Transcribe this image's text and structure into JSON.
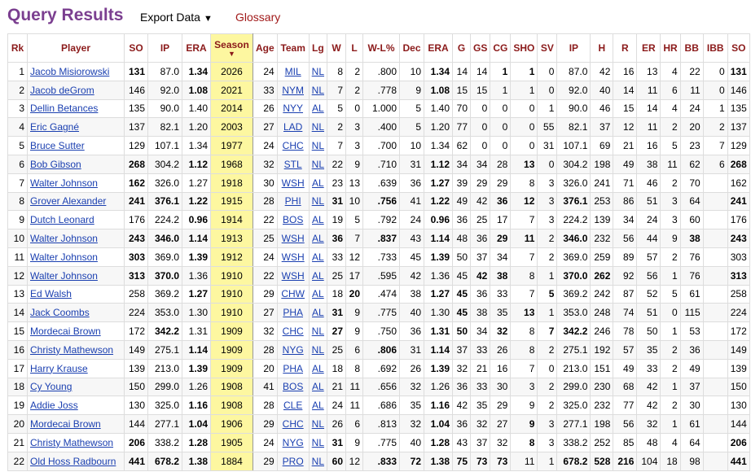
{
  "header": {
    "title": "Query Results",
    "export_label": "Export Data",
    "export_caret": "▼",
    "glossary_label": "Glossary"
  },
  "table": {
    "columns": [
      "Rk",
      "Player",
      "SO",
      "IP",
      "ERA",
      "Season",
      "Age",
      "Team",
      "Lg",
      "W",
      "L",
      "W-L%",
      "Dec",
      "ERA",
      "G",
      "GS",
      "CG",
      "SHO",
      "SV",
      "IP",
      "H",
      "R",
      "ER",
      "HR",
      "BB",
      "IBB",
      "SO"
    ],
    "sort_indicator": "▼",
    "rows": [
      [
        "1",
        "Jacob Misiorowski",
        "131",
        "87.0",
        "1.34",
        "2026",
        "24",
        "MIL",
        "NL",
        "8",
        "2",
        ".800",
        "10",
        "1.34",
        "14",
        "14",
        "1",
        "1",
        "0",
        "87.0",
        "42",
        "16",
        "13",
        "4",
        "22",
        "0",
        "131"
      ],
      [
        "2",
        "Jacob deGrom",
        "146",
        "92.0",
        "1.08",
        "2021",
        "33",
        "NYM",
        "NL",
        "7",
        "2",
        ".778",
        "9",
        "1.08",
        "15",
        "15",
        "1",
        "1",
        "0",
        "92.0",
        "40",
        "14",
        "11",
        "6",
        "11",
        "0",
        "146"
      ],
      [
        "3",
        "Dellin Betances",
        "135",
        "90.0",
        "1.40",
        "2014",
        "26",
        "NYY",
        "AL",
        "5",
        "0",
        "1.000",
        "5",
        "1.40",
        "70",
        "0",
        "0",
        "0",
        "1",
        "90.0",
        "46",
        "15",
        "14",
        "4",
        "24",
        "1",
        "135"
      ],
      [
        "4",
        "Eric Gagné",
        "137",
        "82.1",
        "1.20",
        "2003",
        "27",
        "LAD",
        "NL",
        "2",
        "3",
        ".400",
        "5",
        "1.20",
        "77",
        "0",
        "0",
        "0",
        "55",
        "82.1",
        "37",
        "12",
        "11",
        "2",
        "20",
        "2",
        "137"
      ],
      [
        "5",
        "Bruce Sutter",
        "129",
        "107.1",
        "1.34",
        "1977",
        "24",
        "CHC",
        "NL",
        "7",
        "3",
        ".700",
        "10",
        "1.34",
        "62",
        "0",
        "0",
        "0",
        "31",
        "107.1",
        "69",
        "21",
        "16",
        "5",
        "23",
        "7",
        "129"
      ],
      [
        "6",
        "Bob Gibson",
        "268",
        "304.2",
        "1.12",
        "1968",
        "32",
        "STL",
        "NL",
        "22",
        "9",
        ".710",
        "31",
        "1.12",
        "34",
        "34",
        "28",
        "13",
        "0",
        "304.2",
        "198",
        "49",
        "38",
        "11",
        "62",
        "6",
        "268"
      ],
      [
        "7",
        "Walter Johnson",
        "162",
        "326.0",
        "1.27",
        "1918",
        "30",
        "WSH",
        "AL",
        "23",
        "13",
        ".639",
        "36",
        "1.27",
        "39",
        "29",
        "29",
        "8",
        "3",
        "326.0",
        "241",
        "71",
        "46",
        "2",
        "70",
        "",
        "162"
      ],
      [
        "8",
        "Grover Alexander",
        "241",
        "376.1",
        "1.22",
        "1915",
        "28",
        "PHI",
        "NL",
        "31",
        "10",
        ".756",
        "41",
        "1.22",
        "49",
        "42",
        "36",
        "12",
        "3",
        "376.1",
        "253",
        "86",
        "51",
        "3",
        "64",
        "",
        "241"
      ],
      [
        "9",
        "Dutch Leonard",
        "176",
        "224.2",
        "0.96",
        "1914",
        "22",
        "BOS",
        "AL",
        "19",
        "5",
        ".792",
        "24",
        "0.96",
        "36",
        "25",
        "17",
        "7",
        "3",
        "224.2",
        "139",
        "34",
        "24",
        "3",
        "60",
        "",
        "176"
      ],
      [
        "10",
        "Walter Johnson",
        "243",
        "346.0",
        "1.14",
        "1913",
        "25",
        "WSH",
        "AL",
        "36",
        "7",
        ".837",
        "43",
        "1.14",
        "48",
        "36",
        "29",
        "11",
        "2",
        "346.0",
        "232",
        "56",
        "44",
        "9",
        "38",
        "",
        "243"
      ],
      [
        "11",
        "Walter Johnson",
        "303",
        "369.0",
        "1.39",
        "1912",
        "24",
        "WSH",
        "AL",
        "33",
        "12",
        ".733",
        "45",
        "1.39",
        "50",
        "37",
        "34",
        "7",
        "2",
        "369.0",
        "259",
        "89",
        "57",
        "2",
        "76",
        "",
        "303"
      ],
      [
        "12",
        "Walter Johnson",
        "313",
        "370.0",
        "1.36",
        "1910",
        "22",
        "WSH",
        "AL",
        "25",
        "17",
        ".595",
        "42",
        "1.36",
        "45",
        "42",
        "38",
        "8",
        "1",
        "370.0",
        "262",
        "92",
        "56",
        "1",
        "76",
        "",
        "313"
      ],
      [
        "13",
        "Ed Walsh",
        "258",
        "369.2",
        "1.27",
        "1910",
        "29",
        "CHW",
        "AL",
        "18",
        "20",
        ".474",
        "38",
        "1.27",
        "45",
        "36",
        "33",
        "7",
        "5",
        "369.2",
        "242",
        "87",
        "52",
        "5",
        "61",
        "",
        "258"
      ],
      [
        "14",
        "Jack Coombs",
        "224",
        "353.0",
        "1.30",
        "1910",
        "27",
        "PHA",
        "AL",
        "31",
        "9",
        ".775",
        "40",
        "1.30",
        "45",
        "38",
        "35",
        "13",
        "1",
        "353.0",
        "248",
        "74",
        "51",
        "0",
        "115",
        "",
        "224"
      ],
      [
        "15",
        "Mordecai Brown",
        "172",
        "342.2",
        "1.31",
        "1909",
        "32",
        "CHC",
        "NL",
        "27",
        "9",
        ".750",
        "36",
        "1.31",
        "50",
        "34",
        "32",
        "8",
        "7",
        "342.2",
        "246",
        "78",
        "50",
        "1",
        "53",
        "",
        "172"
      ],
      [
        "16",
        "Christy Mathewson",
        "149",
        "275.1",
        "1.14",
        "1909",
        "28",
        "NYG",
        "NL",
        "25",
        "6",
        ".806",
        "31",
        "1.14",
        "37",
        "33",
        "26",
        "8",
        "2",
        "275.1",
        "192",
        "57",
        "35",
        "2",
        "36",
        "",
        "149"
      ],
      [
        "17",
        "Harry Krause",
        "139",
        "213.0",
        "1.39",
        "1909",
        "20",
        "PHA",
        "AL",
        "18",
        "8",
        ".692",
        "26",
        "1.39",
        "32",
        "21",
        "16",
        "7",
        "0",
        "213.0",
        "151",
        "49",
        "33",
        "2",
        "49",
        "",
        "139"
      ],
      [
        "18",
        "Cy Young",
        "150",
        "299.0",
        "1.26",
        "1908",
        "41",
        "BOS",
        "AL",
        "21",
        "11",
        ".656",
        "32",
        "1.26",
        "36",
        "33",
        "30",
        "3",
        "2",
        "299.0",
        "230",
        "68",
        "42",
        "1",
        "37",
        "",
        "150"
      ],
      [
        "19",
        "Addie Joss",
        "130",
        "325.0",
        "1.16",
        "1908",
        "28",
        "CLE",
        "AL",
        "24",
        "11",
        ".686",
        "35",
        "1.16",
        "42",
        "35",
        "29",
        "9",
        "2",
        "325.0",
        "232",
        "77",
        "42",
        "2",
        "30",
        "",
        "130"
      ],
      [
        "20",
        "Mordecai Brown",
        "144",
        "277.1",
        "1.04",
        "1906",
        "29",
        "CHC",
        "NL",
        "26",
        "6",
        ".813",
        "32",
        "1.04",
        "36",
        "32",
        "27",
        "9",
        "3",
        "277.1",
        "198",
        "56",
        "32",
        "1",
        "61",
        "",
        "144"
      ],
      [
        "21",
        "Christy Mathewson",
        "206",
        "338.2",
        "1.28",
        "1905",
        "24",
        "NYG",
        "NL",
        "31",
        "9",
        ".775",
        "40",
        "1.28",
        "43",
        "37",
        "32",
        "8",
        "3",
        "338.2",
        "252",
        "85",
        "48",
        "4",
        "64",
        "",
        "206"
      ],
      [
        "22",
        "Old Hoss Radbourn",
        "441",
        "678.2",
        "1.38",
        "1884",
        "29",
        "PRO",
        "NL",
        "60",
        "12",
        ".833",
        "72",
        "1.38",
        "75",
        "73",
        "73",
        "11",
        "1",
        "678.2",
        "528",
        "216",
        "104",
        "18",
        "98",
        "",
        "441"
      ]
    ]
  }
}
